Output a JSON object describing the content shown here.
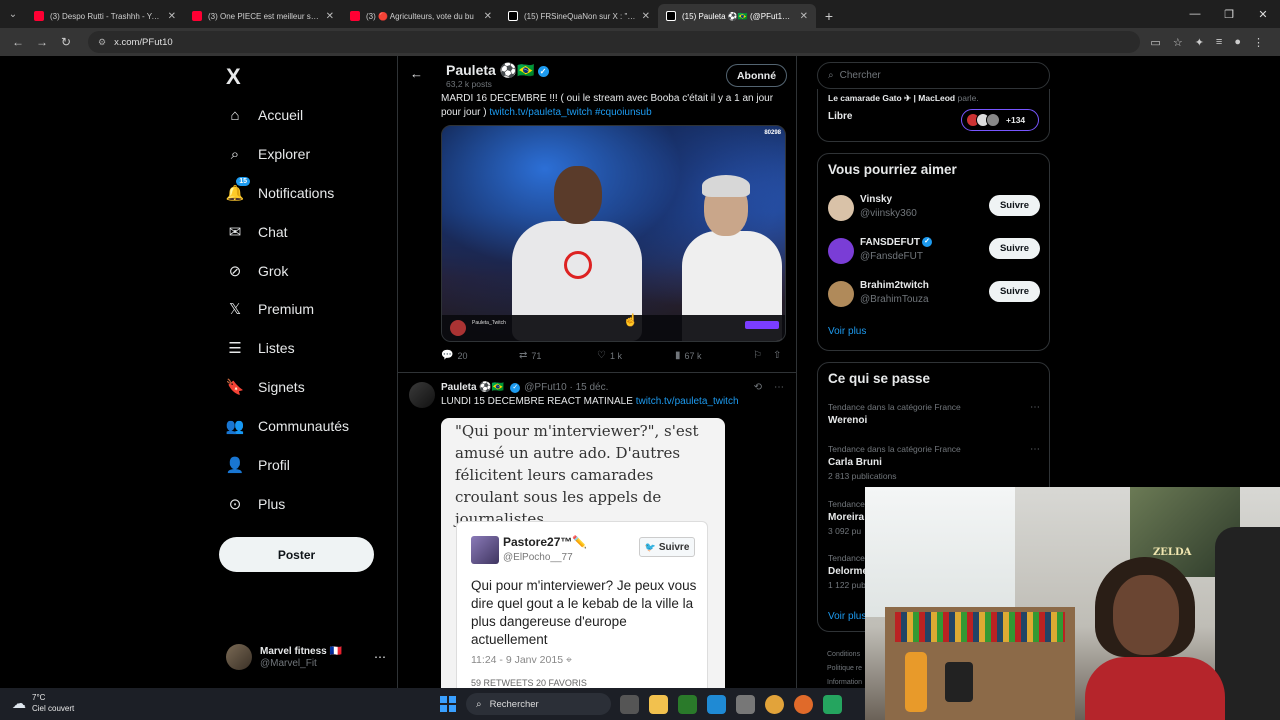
{
  "browser": {
    "tabs": [
      {
        "label": "(3) Despo Rutti - Trashhh - YouT",
        "favicon": "youtube-icon",
        "active": false
      },
      {
        "label": "(3) One PIECE est meilleur sans",
        "favicon": "youtube-icon",
        "active": false
      },
      {
        "label": "(3) 🔴 Agriculteurs, vote du bu",
        "favicon": "youtube-icon",
        "active": false
      },
      {
        "label": "(15) FRSineQuaNon sur X : \"@T",
        "favicon": "x-icon",
        "active": false
      },
      {
        "label": "(15) Pauleta ⚽🇧🇷 (@PFut10) / X",
        "favicon": "x-icon",
        "active": true
      }
    ],
    "url": "x.com/PFut10"
  },
  "nav": {
    "logo": "X",
    "items": [
      {
        "label": "Accueil",
        "icon": "home-icon"
      },
      {
        "label": "Explorer",
        "icon": "search-icon"
      },
      {
        "label": "Notifications",
        "icon": "bell-icon",
        "badge": "15"
      },
      {
        "label": "Chat",
        "icon": "mail-icon"
      },
      {
        "label": "Grok",
        "icon": "grok-icon"
      },
      {
        "label": "Premium",
        "icon": "x-premium-icon"
      },
      {
        "label": "Listes",
        "icon": "list-icon"
      },
      {
        "label": "Signets",
        "icon": "bookmark-icon"
      },
      {
        "label": "Communautés",
        "icon": "communities-icon"
      },
      {
        "label": "Profil",
        "icon": "person-icon"
      },
      {
        "label": "Plus",
        "icon": "more-circle-icon"
      }
    ],
    "post_button": "Poster",
    "account": {
      "name": "Marvel fitness 🇫🇷",
      "handle": "@Marvel_Fit"
    }
  },
  "profile": {
    "name": "Pauleta ⚽🇧🇷",
    "posts": "63,2 k posts",
    "follow_state": "Abonné"
  },
  "tweet1": {
    "text_plain": "MARDI 16 DECEMBRE !!! ( oui le stream avec Booba c'était il y a 1 an jour pour jour )",
    "link": "twitch.tv/pauleta_twitch",
    "hashtag": "#cquoiunsub",
    "media_label": "80298",
    "stream_name": "Pauleta_Twitch",
    "stats": {
      "replies": "20",
      "reposts": "71",
      "likes": "1 k",
      "views": "67 k"
    }
  },
  "tweet2": {
    "name": "Pauleta ⚽🇧🇷",
    "handle": "@PFut10",
    "date": "15 déc.",
    "text_plain": "LUNDI 15 DECEMBRE REACT MATINALE",
    "link": "twitch.tv/pauleta_twitch",
    "article_quote": "\"Qui pour m'interviewer?\", s'est amusé un autre ado. D'autres félicitent leurs camarades croulant sous les appels de journalistes.",
    "embed": {
      "name": "Pastore27™✏️",
      "handle": "@ElPocho__77",
      "follow": "Suivre",
      "text": "Qui pour m'interviewer? Je peux vous dire quel gout a le kebab de la ville la plus dangereuse d'europe actuellement",
      "date": "11:24 - 9 Janv 2015",
      "stats": "59 RETWEETS   20 FAVORIS"
    }
  },
  "right": {
    "search_placeholder": "Chercher",
    "space": {
      "host": "Le camarade Gato ✈ | MacLeod",
      "action": "parle.",
      "title": "Libre",
      "listeners": "+134"
    },
    "suggestions_title": "Vous pourriez aimer",
    "suggestions": [
      {
        "name": "Vinsky",
        "handle": "@viinsky360",
        "button": "Suivre",
        "verified": false
      },
      {
        "name": "FANSDEFUT",
        "handle": "@FansdeFUT",
        "button": "Suivre",
        "verified": true
      },
      {
        "name": "Brahim2twitch",
        "handle": "@BrahimTouza",
        "button": "Suivre",
        "verified": false
      }
    ],
    "see_more": "Voir plus",
    "trends_title": "Ce qui se passe",
    "trends": [
      {
        "category": "Tendance dans la catégorie France",
        "name": "Werenoi",
        "count": ""
      },
      {
        "category": "Tendance dans la catégorie France",
        "name": "Carla Bruni",
        "count": "2 813 publications"
      },
      {
        "category": "Tendance",
        "name": "Moreira",
        "count": "3 092 pu"
      },
      {
        "category": "Tendance",
        "name": "Delorme",
        "count": "1 122 publ"
      }
    ],
    "trends_see_more": "Voir plus",
    "footer": [
      "Conditions",
      "Politique re",
      "Information"
    ]
  },
  "webcam": {
    "poster_text": "ZELDA"
  },
  "taskbar": {
    "temp": "7°C",
    "weather": "Ciel couvert",
    "search": "Rechercher"
  }
}
